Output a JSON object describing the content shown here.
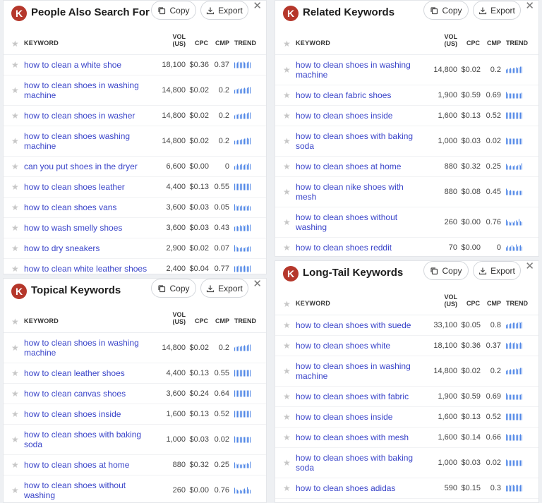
{
  "headers": {
    "keyword": "KEYWORD",
    "vol_line1": "VOL",
    "vol_line2": "(US)",
    "cpc": "CPC",
    "cmp": "CMP",
    "trend": "TREND"
  },
  "buttons": {
    "copy": "Copy",
    "export": "Export"
  },
  "icons": {
    "logo_letter": "K",
    "close": "✕",
    "star": "★"
  },
  "colors": {
    "keyword_link": "#3a45c9",
    "trend_bar": "#4f86e6",
    "logo_bg": "#b5372b"
  },
  "panels": [
    {
      "title": "People Also Search For",
      "rows": [
        {
          "keyword": "how to clean a white shoe",
          "vol": "18,100",
          "cpc": "$0.36",
          "cmp": "0.37",
          "trend": [
            8,
            7,
            8,
            9,
            8,
            8,
            9,
            8,
            7,
            8,
            9,
            8
          ]
        },
        {
          "keyword": "how to clean shoes in washing machine",
          "vol": "14,800",
          "cpc": "$0.02",
          "cmp": "0.2",
          "trend": [
            5,
            6,
            6,
            7,
            6,
            7,
            7,
            8,
            7,
            8,
            9,
            9
          ]
        },
        {
          "keyword": "how to clean shoes in washer",
          "vol": "14,800",
          "cpc": "$0.02",
          "cmp": "0.2",
          "trend": [
            5,
            6,
            6,
            7,
            6,
            7,
            7,
            8,
            7,
            8,
            9,
            9
          ]
        },
        {
          "keyword": "how to clean shoes washing machine",
          "vol": "14,800",
          "cpc": "$0.02",
          "cmp": "0.2",
          "trend": [
            5,
            5,
            6,
            6,
            6,
            7,
            7,
            8,
            8,
            9,
            8,
            9
          ]
        },
        {
          "keyword": "can you put shoes in the dryer",
          "vol": "6,600",
          "cpc": "$0.00",
          "cmp": "0",
          "trend": [
            5,
            6,
            8,
            6,
            7,
            8,
            6,
            7,
            8,
            7,
            9,
            8
          ]
        },
        {
          "keyword": "how to clean shoes leather",
          "vol": "4,400",
          "cpc": "$0.13",
          "cmp": "0.55",
          "trend": [
            9,
            9,
            9,
            9,
            9,
            9,
            9,
            9,
            9,
            9,
            9,
            9
          ]
        },
        {
          "keyword": "how to clean shoes vans",
          "vol": "3,600",
          "cpc": "$0.03",
          "cmp": "0.05",
          "trend": [
            8,
            6,
            5,
            6,
            5,
            6,
            5,
            5,
            6,
            5,
            6,
            5
          ]
        },
        {
          "keyword": "how to wash smelly shoes",
          "vol": "3,600",
          "cpc": "$0.03",
          "cmp": "0.43",
          "trend": [
            6,
            7,
            7,
            6,
            8,
            7,
            8,
            7,
            8,
            9,
            8,
            9
          ]
        },
        {
          "keyword": "how to dry sneakers",
          "vol": "2,900",
          "cpc": "$0.02",
          "cmp": "0.07",
          "trend": [
            9,
            7,
            6,
            5,
            5,
            6,
            5,
            5,
            6,
            6,
            7,
            7
          ]
        },
        {
          "keyword": "how to clean white leather shoes",
          "vol": "2,400",
          "cpc": "$0.04",
          "cmp": "0.77",
          "trend": [
            8,
            8,
            8,
            9,
            8,
            8,
            8,
            9,
            8,
            8,
            8,
            9
          ]
        }
      ]
    },
    {
      "title": "Related Keywords",
      "rows": [
        {
          "keyword": "how to clean shoes in washing machine",
          "vol": "14,800",
          "cpc": "$0.02",
          "cmp": "0.2",
          "trend": [
            5,
            6,
            6,
            7,
            6,
            7,
            7,
            8,
            7,
            8,
            9,
            9
          ]
        },
        {
          "keyword": "how to clean fabric shoes",
          "vol": "1,900",
          "cpc": "$0.59",
          "cmp": "0.69",
          "trend": [
            8,
            6,
            6,
            6,
            6,
            6,
            6,
            6,
            6,
            6,
            6,
            7
          ]
        },
        {
          "keyword": "how to clean shoes inside",
          "vol": "1,600",
          "cpc": "$0.13",
          "cmp": "0.52",
          "trend": [
            9,
            9,
            9,
            9,
            9,
            9,
            9,
            9,
            9,
            9,
            9,
            9
          ]
        },
        {
          "keyword": "how to clean shoes with baking soda",
          "vol": "1,000",
          "cpc": "$0.03",
          "cmp": "0.02",
          "trend": [
            9,
            8,
            8,
            8,
            8,
            8,
            8,
            8,
            8,
            8,
            8,
            8
          ]
        },
        {
          "keyword": "how to clean shoes at home",
          "vol": "880",
          "cpc": "$0.32",
          "cmp": "0.25",
          "trend": [
            8,
            6,
            5,
            6,
            5,
            5,
            6,
            5,
            6,
            7,
            6,
            9
          ]
        },
        {
          "keyword": "how to clean nike shoes with mesh",
          "vol": "880",
          "cpc": "$0.08",
          "cmp": "0.45",
          "trend": [
            9,
            7,
            6,
            7,
            6,
            6,
            6,
            5,
            6,
            6,
            6,
            6
          ]
        },
        {
          "keyword": "how to clean shoes without washing",
          "vol": "260",
          "cpc": "$0.00",
          "cmp": "0.76",
          "trend": [
            8,
            6,
            5,
            4,
            5,
            4,
            6,
            7,
            5,
            9,
            6,
            5
          ]
        },
        {
          "keyword": "how to clean shoes reddit",
          "vol": "70",
          "cpc": "$0.00",
          "cmp": "0",
          "trend": [
            5,
            7,
            5,
            6,
            8,
            6,
            5,
            9,
            6,
            7,
            8,
            6
          ]
        }
      ]
    },
    {
      "title": "Topical Keywords",
      "rows": [
        {
          "keyword": "how to clean shoes in washing machine",
          "vol": "14,800",
          "cpc": "$0.02",
          "cmp": "0.2",
          "trend": [
            5,
            6,
            6,
            7,
            6,
            7,
            7,
            8,
            7,
            8,
            9,
            9
          ]
        },
        {
          "keyword": "how to clean leather shoes",
          "vol": "4,400",
          "cpc": "$0.13",
          "cmp": "0.55",
          "trend": [
            9,
            9,
            9,
            9,
            9,
            9,
            9,
            9,
            9,
            9,
            9,
            9
          ]
        },
        {
          "keyword": "how to clean canvas shoes",
          "vol": "3,600",
          "cpc": "$0.24",
          "cmp": "0.64",
          "trend": [
            9,
            9,
            9,
            9,
            9,
            9,
            9,
            9,
            9,
            9,
            9,
            9
          ]
        },
        {
          "keyword": "how to clean shoes inside",
          "vol": "1,600",
          "cpc": "$0.13",
          "cmp": "0.52",
          "trend": [
            9,
            9,
            9,
            9,
            9,
            9,
            9,
            9,
            9,
            9,
            9,
            9
          ]
        },
        {
          "keyword": "how to clean shoes with baking soda",
          "vol": "1,000",
          "cpc": "$0.03",
          "cmp": "0.02",
          "trend": [
            9,
            8,
            8,
            8,
            8,
            8,
            8,
            8,
            8,
            8,
            8,
            8
          ]
        },
        {
          "keyword": "how to clean shoes at home",
          "vol": "880",
          "cpc": "$0.32",
          "cmp": "0.25",
          "trend": [
            8,
            6,
            5,
            6,
            5,
            5,
            6,
            5,
            6,
            7,
            6,
            9
          ]
        },
        {
          "keyword": "how to clean shoes without washing",
          "vol": "260",
          "cpc": "$0.00",
          "cmp": "0.76",
          "trend": [
            8,
            6,
            5,
            4,
            5,
            4,
            6,
            7,
            5,
            9,
            6,
            5
          ]
        }
      ]
    },
    {
      "title": "Long-Tail Keywords",
      "rows": [
        {
          "keyword": "how to clean shoes with suede",
          "vol": "33,100",
          "cpc": "$0.05",
          "cmp": "0.8",
          "trend": [
            5,
            6,
            6,
            7,
            7,
            8,
            8,
            7,
            8,
            9,
            8,
            9
          ]
        },
        {
          "keyword": "how to clean shoes white",
          "vol": "18,100",
          "cpc": "$0.36",
          "cmp": "0.37",
          "trend": [
            8,
            7,
            8,
            9,
            8,
            8,
            9,
            8,
            7,
            8,
            9,
            8
          ]
        },
        {
          "keyword": "how to clean shoes in washing machine",
          "vol": "14,800",
          "cpc": "$0.02",
          "cmp": "0.2",
          "trend": [
            5,
            6,
            6,
            7,
            6,
            7,
            7,
            8,
            7,
            8,
            9,
            9
          ]
        },
        {
          "keyword": "how to clean shoes with fabric",
          "vol": "1,900",
          "cpc": "$0.59",
          "cmp": "0.69",
          "trend": [
            8,
            6,
            6,
            6,
            6,
            6,
            6,
            6,
            6,
            6,
            6,
            7
          ]
        },
        {
          "keyword": "how to clean shoes inside",
          "vol": "1,600",
          "cpc": "$0.13",
          "cmp": "0.52",
          "trend": [
            9,
            9,
            9,
            9,
            9,
            9,
            9,
            9,
            9,
            9,
            9,
            9
          ]
        },
        {
          "keyword": "how to clean shoes with mesh",
          "vol": "1,600",
          "cpc": "$0.14",
          "cmp": "0.66",
          "trend": [
            9,
            8,
            8,
            8,
            8,
            9,
            8,
            8,
            8,
            8,
            9,
            8
          ]
        },
        {
          "keyword": "how to clean shoes with baking soda",
          "vol": "1,000",
          "cpc": "$0.03",
          "cmp": "0.02",
          "trend": [
            9,
            8,
            8,
            8,
            8,
            8,
            8,
            8,
            8,
            8,
            8,
            8
          ]
        },
        {
          "keyword": "how to clean shoes adidas",
          "vol": "590",
          "cpc": "$0.15",
          "cmp": "0.3",
          "trend": [
            7,
            7,
            8,
            7,
            8,
            8,
            7,
            8,
            8,
            7,
            8,
            8
          ]
        }
      ]
    }
  ]
}
